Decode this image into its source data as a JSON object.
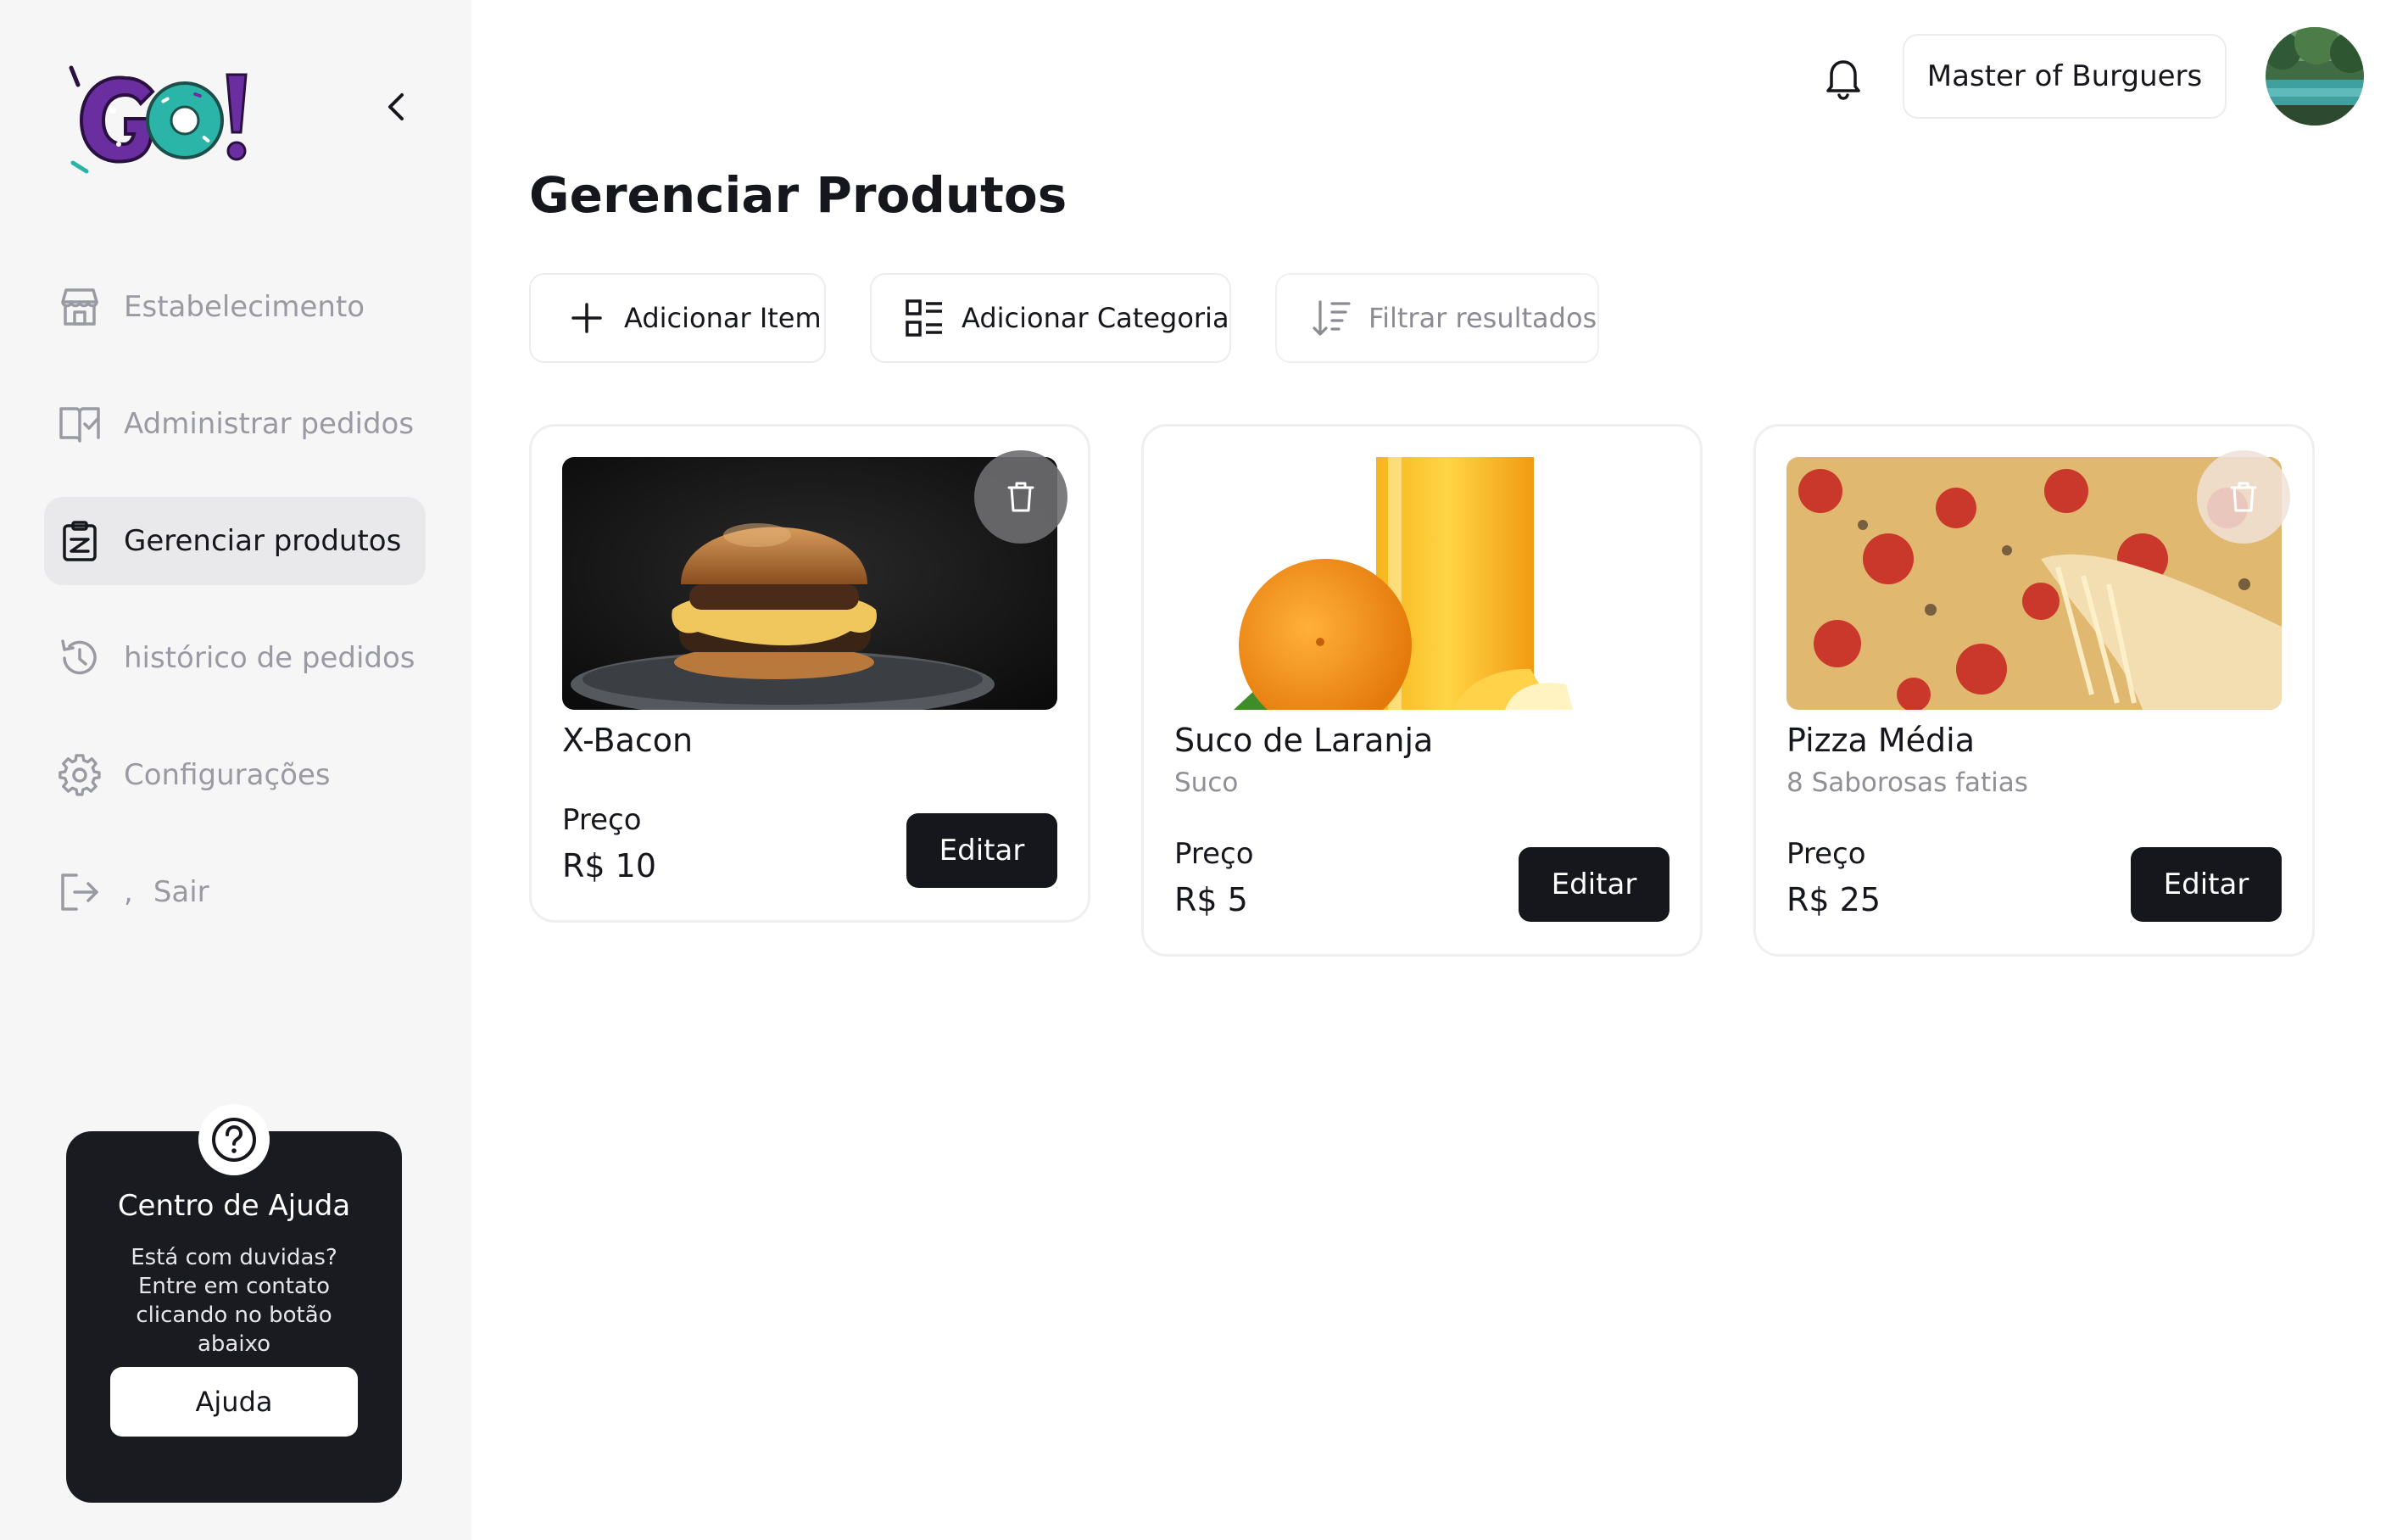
{
  "app": {
    "logo_text": "GO!",
    "colors": {
      "accent": "#16171c",
      "logo_purple": "#6a2ea0",
      "logo_teal": "#2bb5a8",
      "sidebar_bg": "#f6f6f7"
    }
  },
  "sidebar": {
    "items": [
      {
        "label": "Estabelecimento",
        "icon": "store-icon",
        "active": false
      },
      {
        "label": "Administrar pedidos",
        "icon": "book-check-icon",
        "active": false
      },
      {
        "label": "Gerenciar produtos",
        "icon": "clipboard-icon",
        "active": true
      },
      {
        "label": "histórico de pedidos",
        "icon": "history-icon",
        "active": false
      },
      {
        "label": "Configurações",
        "icon": "gear-icon",
        "active": false
      },
      {
        "label": "Sair",
        "separator": ",",
        "icon": "logout-icon",
        "active": false
      }
    ]
  },
  "help": {
    "title": "Centro de Ajuda",
    "text": "Está com duvidas? Entre em contato clicando no botão abaixo",
    "button_label": "Ajuda"
  },
  "header": {
    "store_name": "Master of Burguers"
  },
  "page": {
    "title": "Gerenciar Produtos"
  },
  "toolbar": {
    "add_item_label": "Adicionar Item",
    "add_category_label": "Adicionar Categoria",
    "filter_label": "Filtrar resultados"
  },
  "products": [
    {
      "name": "X-Bacon",
      "description": "",
      "price_label": "Preço",
      "price": "R$ 10",
      "edit_label": "Editar",
      "image": "burger"
    },
    {
      "name": "Suco de Laranja",
      "description": "Suco",
      "price_label": "Preço",
      "price": "R$ 5",
      "edit_label": "Editar",
      "image": "orange-juice"
    },
    {
      "name": "Pizza Média",
      "description": "8 Saborosas fatias",
      "price_label": "Preço",
      "price": "R$ 25",
      "edit_label": "Editar",
      "image": "pizza"
    }
  ]
}
